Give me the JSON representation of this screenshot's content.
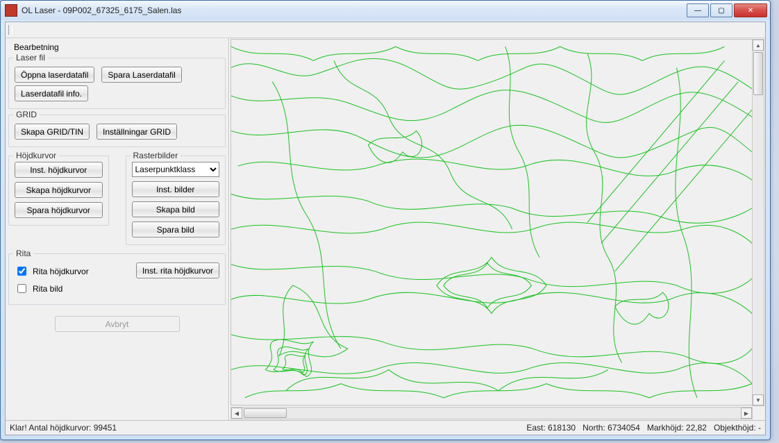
{
  "window": {
    "title": "OL Laser - 09P002_67325_6175_Salen.las"
  },
  "panel": {
    "title": "Bearbetning",
    "laser": {
      "title": "Laser fil",
      "open": "Öppna laserdatafil",
      "save": "Spara Laserdatafil",
      "info": "Laserdatafil info."
    },
    "grid": {
      "title": "GRID",
      "create": "Skapa GRID/TIN",
      "settings": "Inställningar GRID"
    },
    "contours": {
      "title": "Höjdkurvor",
      "settings": "Inst. höjdkurvor",
      "create": "Skapa höjdkurvor",
      "save": "Spara höjdkurvor"
    },
    "raster": {
      "title": "Rasterbilder",
      "combo_selected": "Laserpunktklass",
      "settings": "Inst. bilder",
      "create": "Skapa bild",
      "save": "Spara bild"
    },
    "draw": {
      "title": "Rita",
      "chk_contours": "Rita höjdkurvor",
      "chk_image": "Rita bild",
      "settings": "Inst. rita höjdkurvor"
    },
    "cancel": "Avbryt"
  },
  "status": {
    "left": "Klar! Antal höjdkurvor: 99451",
    "east_label": "East:",
    "east_value": "618130",
    "north_label": "North:",
    "north_value": "6734054",
    "ground_label": "Markhöjd:",
    "ground_value": "22,82",
    "obj_label": "Objekthöjd:",
    "obj_value": "-"
  }
}
